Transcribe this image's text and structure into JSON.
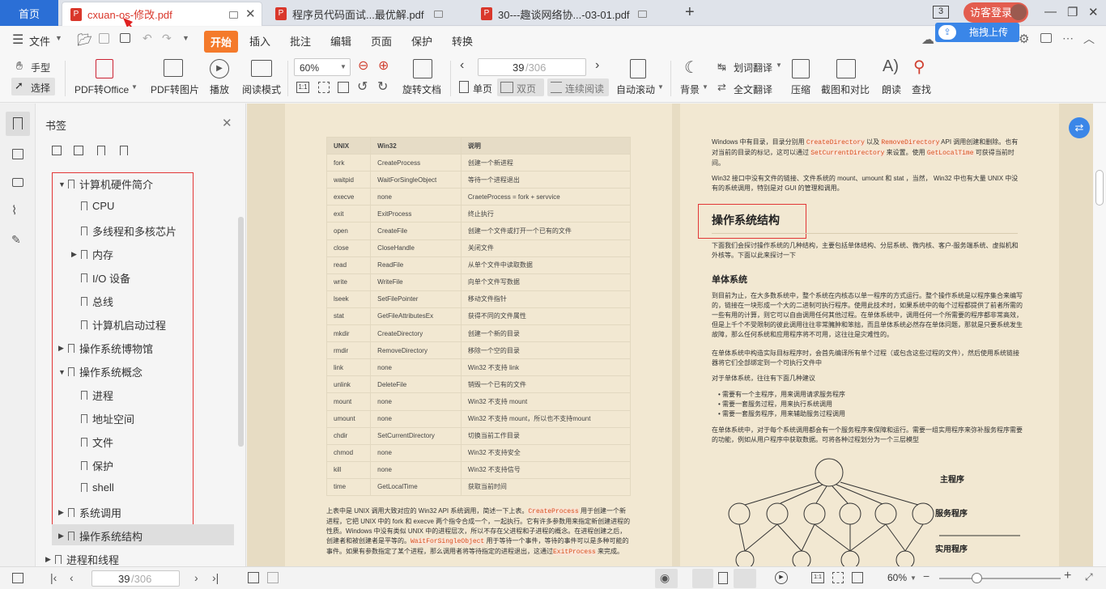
{
  "tabs": {
    "home": "首页",
    "doc1": "cxuan-os-修改.pdf",
    "doc2": "程序员代码面试...最优解.pdf",
    "doc3": "30---趣谈网络协...-03-01.pdf",
    "new_tab": "+"
  },
  "window": {
    "page_badge": "3",
    "login": "访客登录",
    "upload_tip": "拖拽上传",
    "min": "—",
    "max": "❐",
    "close": "✕"
  },
  "menu": {
    "file": "文件",
    "start": "开始",
    "insert": "插入",
    "annotate": "批注",
    "edit": "编辑",
    "page": "页面",
    "protect": "保护",
    "convert": "转换"
  },
  "toolbar": {
    "hand": "手型",
    "select": "选择",
    "pdf_to_office": "PDF转Office",
    "pdf_to_image": "PDF转图片",
    "play": "播放",
    "read_mode": "阅读模式",
    "zoom": "60%",
    "rotate": "旋转文档",
    "page_current": "39",
    "page_total": "/306",
    "single": "单页",
    "double": "双页",
    "continuous": "连续阅读",
    "autoscroll": "自动滚动",
    "background": "背景",
    "word_translate": "划词翻译",
    "full_translate": "全文翻译",
    "compress": "压缩",
    "compare": "截图和对比",
    "read_aloud": "朗读",
    "find": "查找"
  },
  "bookmarks": {
    "title": "书签",
    "items": [
      {
        "label": "计算机硬件简介"
      },
      {
        "label": "CPU"
      },
      {
        "label": "多线程和多核芯片"
      },
      {
        "label": "内存"
      },
      {
        "label": "I/O 设备"
      },
      {
        "label": "总线"
      },
      {
        "label": "计算机启动过程"
      },
      {
        "label": "操作系统博物馆"
      },
      {
        "label": "操作系统概念"
      },
      {
        "label": "进程"
      },
      {
        "label": "地址空间"
      },
      {
        "label": "文件"
      },
      {
        "label": "保护"
      },
      {
        "label": "shell"
      },
      {
        "label": "系统调用"
      },
      {
        "label": "操作系统结构"
      },
      {
        "label": "进程和线程"
      }
    ]
  },
  "left_page": {
    "headers": [
      "UNIX",
      "Win32",
      "说明"
    ],
    "rows": [
      [
        "fork",
        "CreateProcess",
        "创建一个新进程"
      ],
      [
        "waitpid",
        "WaitForSingleObject",
        "等待一个进程退出"
      ],
      [
        "execve",
        "none",
        "CraeteProcess = fork + servvice"
      ],
      [
        "exit",
        "ExitProcess",
        "终止执行"
      ],
      [
        "open",
        "CreateFile",
        "创建一个文件或打开一个已有的文件"
      ],
      [
        "close",
        "CloseHandle",
        "关闭文件"
      ],
      [
        "read",
        "ReadFile",
        "从单个文件中读取数据"
      ],
      [
        "write",
        "WriteFile",
        "向单个文件写数据"
      ],
      [
        "lseek",
        "SetFilePointer",
        "移动文件指针"
      ],
      [
        "stat",
        "GetFileAttributesEx",
        "获得不同的文件属性"
      ],
      [
        "mkdir",
        "CreateDirectory",
        "创建一个新的目录"
      ],
      [
        "rmdir",
        "RemoveDirectory",
        "移除一个空的目录"
      ],
      [
        "link",
        "none",
        "Win32 不支持 link"
      ],
      [
        "unlink",
        "DeleteFile",
        "销毁一个已有的文件"
      ],
      [
        "mount",
        "none",
        "Win32 不支持 mount"
      ],
      [
        "umount",
        "none",
        "Win32 不支持 mount，所以也不支持mount"
      ],
      [
        "chdir",
        "SetCurrentDirectory",
        "切换当前工作目录"
      ],
      [
        "chmod",
        "none",
        "Win32 不支持安全"
      ],
      [
        "kill",
        "none",
        "Win32 不支持信号"
      ],
      [
        "time",
        "GetLocalTime",
        "获取当前时间"
      ]
    ],
    "p1a": "上表中是 UNIX 调用大致对应的 Win32 API 系统调用，简述一下上表。",
    "p1code1": "CreateProcess",
    "p1b": " 用于创建一个新进程，它把 UNIX 中的 fork 和 execve 两个指令合成一个，一起执行。它有许多参数用来指定新创建进程的性质。Windows 中没有类似 UNIX 中的进程层次，所以不存在父进程和子进程的概念。在进程创建之后，创建者和被创建者是平等的。",
    "p1code2": "WaitForSingleObject",
    "p1c": " 用于等待一个事件，等待的事件可以是多种可能的事件。如果有参数指定了某个进程，那么调用者将等待指定的进程退出，这通过",
    "p1code3": "ExitProcess",
    "p1d": " 来完成。"
  },
  "right_page": {
    "p0a": "Windows 中有目录，目录分别用 ",
    "p0code1": "CreateDirectory",
    "p0b": " 以及 ",
    "p0code2": "RemoveDirectory",
    "p0c": " API 调用创建和删除。也有对当前的目录的标记，这可以通过 ",
    "p0code3": "SetCurrentDirectory",
    "p0d": " 来设置。使用 ",
    "p0code4": "GetLocalTime",
    "p0e": " 可获得当前时间。",
    "p1": "Win32 接口中没有文件的链接、文件系统的 mount、umount 和 stat ，当然， Win32 中也有大量 UNIX 中没有的系统调用，特别是对 GUI 的管理和调用。",
    "heading": "操作系统结构",
    "p2": "下面我们会探讨操作系统的几种结构，主要包括单体结构、分层系统、微内核、客户-服务端系统、虚拟机和外核等。下面以此来探讨一下",
    "sub": "单体系统",
    "p3": "到目前为止，在大多数系统中，整个系统在内核态以单一程序的方式运行。整个操作系统是以程序集合来编写的，链接在一块形成一个大的二进制可执行程序。使用此技术时，如果系统中的每个过程都提供了前者所需的一些有用的计算，则它可以自由调用任何其他过程。在单体系统中，调用任何一个所需要的程序都非常高效，但是上千个不受限制的彼此调用往往非常臃肿和笨拙，而且单体系统必然存在单体问题，那就是只要系统发生故障，那么任何系统和应用程序将不可用，这往往是灾难性的。",
    "p4": "在单体系统中构造实际目标程序时，会首先编译所有单个过程（或包含这些过程的文件），然后使用系统链接器将它们全部绑定到一个可执行文件中",
    "p5": "对于单体系统，往往有下面几种建议",
    "bullets": [
      "需要有一个主程序，用来调用请求服务程序",
      "需要一套服务过程，用来执行系统调用",
      "需要一套服务程序，用来辅助服务过程调用"
    ],
    "p6": "在单体系统中，对于每个系统调用都会有一个服务程序来保障和运行。需要一组实用程序来弥补服务程序需要的功能，例如从用户程序中获取数据。可将各种过程划分为一个三层模型",
    "diagram": {
      "main": "主程序",
      "service": "服务程序",
      "utility": "实用程序"
    }
  },
  "bottom": {
    "page_current": "39",
    "page_total": "/306",
    "zoom": "60%"
  }
}
